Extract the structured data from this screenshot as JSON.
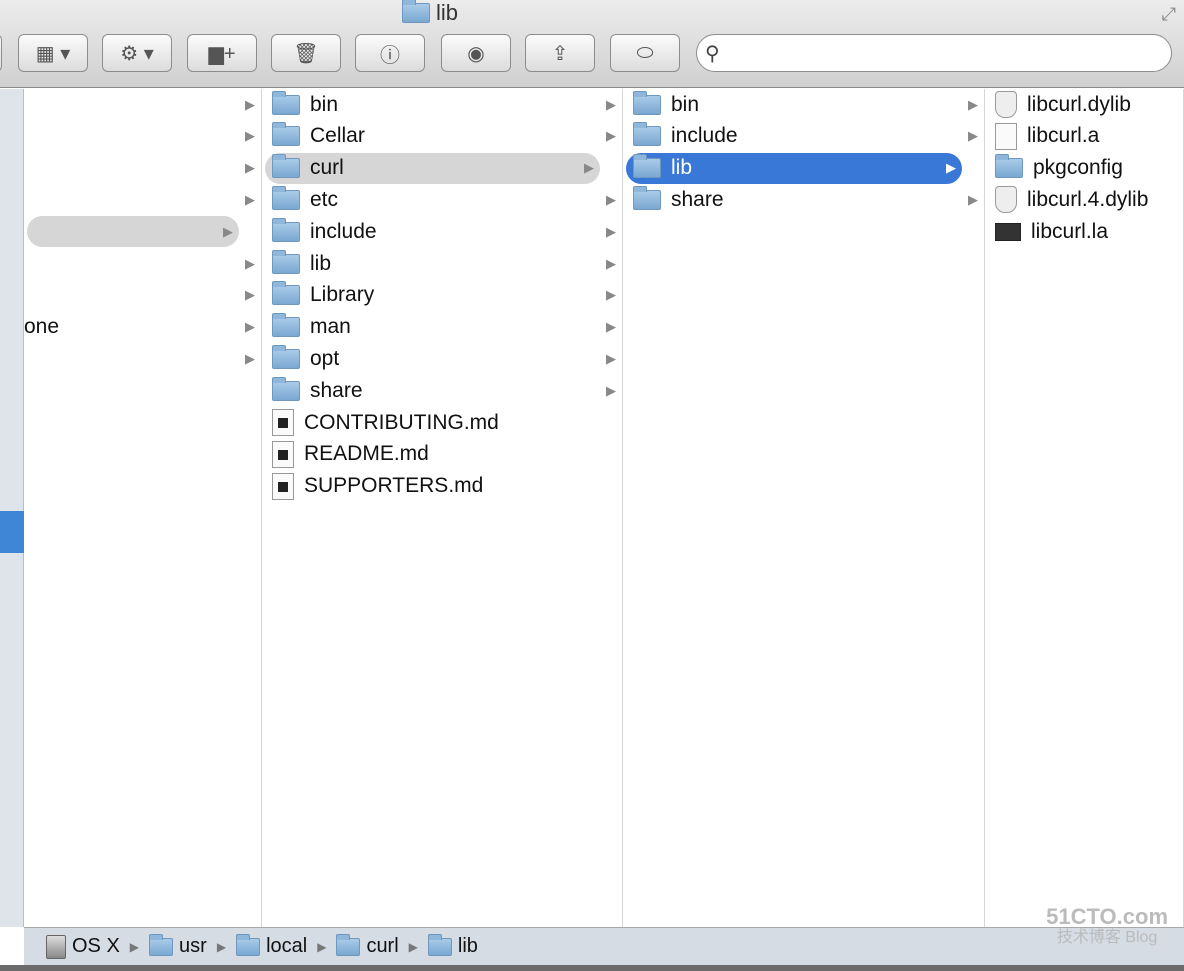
{
  "window": {
    "title": "lib"
  },
  "toolbar": {
    "buttons": [
      {
        "name": "view-options",
        "icon": "grid-icon",
        "glyph": "▦ ▾"
      },
      {
        "name": "action",
        "icon": "gear-icon",
        "glyph": "⚙ ▾"
      },
      {
        "name": "new-folder",
        "icon": "new-folder-icon",
        "glyph": "▆+"
      },
      {
        "name": "delete",
        "icon": "trash-icon",
        "glyph": "🗑"
      },
      {
        "name": "get-info",
        "icon": "info-icon",
        "glyph": "ⓘ"
      },
      {
        "name": "quick-look",
        "icon": "eye-icon",
        "glyph": "◉"
      },
      {
        "name": "share",
        "icon": "share-icon",
        "glyph": "⇪"
      },
      {
        "name": "toggle",
        "icon": "toggle-icon",
        "glyph": "⬭"
      }
    ],
    "search_placeholder": ""
  },
  "columns": [
    {
      "items": [
        {
          "label": "",
          "arrow": true
        },
        {
          "label": "",
          "arrow": true
        },
        {
          "label": "",
          "arrow": true
        },
        {
          "label": "",
          "arrow": true
        },
        {
          "label": "",
          "arrow": true,
          "state": "highlight"
        },
        {
          "label": "",
          "arrow": true
        },
        {
          "label": "",
          "arrow": true
        },
        {
          "label": "one",
          "arrow": true
        },
        {
          "label": "",
          "arrow": true
        }
      ]
    },
    {
      "items": [
        {
          "label": "bin",
          "type": "folder",
          "arrow": true
        },
        {
          "label": "Cellar",
          "type": "folder",
          "arrow": true
        },
        {
          "label": "curl",
          "type": "folder",
          "arrow": true,
          "state": "highlight"
        },
        {
          "label": "etc",
          "type": "folder",
          "arrow": true
        },
        {
          "label": "include",
          "type": "folder",
          "arrow": true
        },
        {
          "label": "lib",
          "type": "folder",
          "arrow": true
        },
        {
          "label": "Library",
          "type": "folder",
          "arrow": true
        },
        {
          "label": "man",
          "type": "folder",
          "arrow": true
        },
        {
          "label": "opt",
          "type": "folder",
          "arrow": true
        },
        {
          "label": "share",
          "type": "folder",
          "arrow": true
        },
        {
          "label": "CONTRIBUTING.md",
          "type": "doc"
        },
        {
          "label": "README.md",
          "type": "doc"
        },
        {
          "label": "SUPPORTERS.md",
          "type": "doc"
        }
      ]
    },
    {
      "items": [
        {
          "label": "bin",
          "type": "folder",
          "arrow": true
        },
        {
          "label": "include",
          "type": "folder",
          "arrow": true
        },
        {
          "label": "lib",
          "type": "folder",
          "arrow": true,
          "state": "selected"
        },
        {
          "label": "share",
          "type": "folder",
          "arrow": true
        }
      ]
    },
    {
      "items": [
        {
          "label": "libcurl.dylib",
          "type": "alias"
        },
        {
          "label": "libcurl.a",
          "type": "file"
        },
        {
          "label": "pkgconfig",
          "type": "folder"
        },
        {
          "label": "libcurl.4.dylib",
          "type": "shield"
        },
        {
          "label": "libcurl.la",
          "type": "dark"
        }
      ]
    }
  ],
  "pathbar": [
    {
      "label": "OS X",
      "icon": "disk-icon"
    },
    {
      "label": "usr",
      "icon": "folder-icon"
    },
    {
      "label": "local",
      "icon": "folder-icon"
    },
    {
      "label": "curl",
      "icon": "folder-icon"
    },
    {
      "label": "lib",
      "icon": "folder-icon"
    }
  ],
  "watermark": {
    "line1": "51CTO.com",
    "line2": "技术博客 Blog"
  }
}
